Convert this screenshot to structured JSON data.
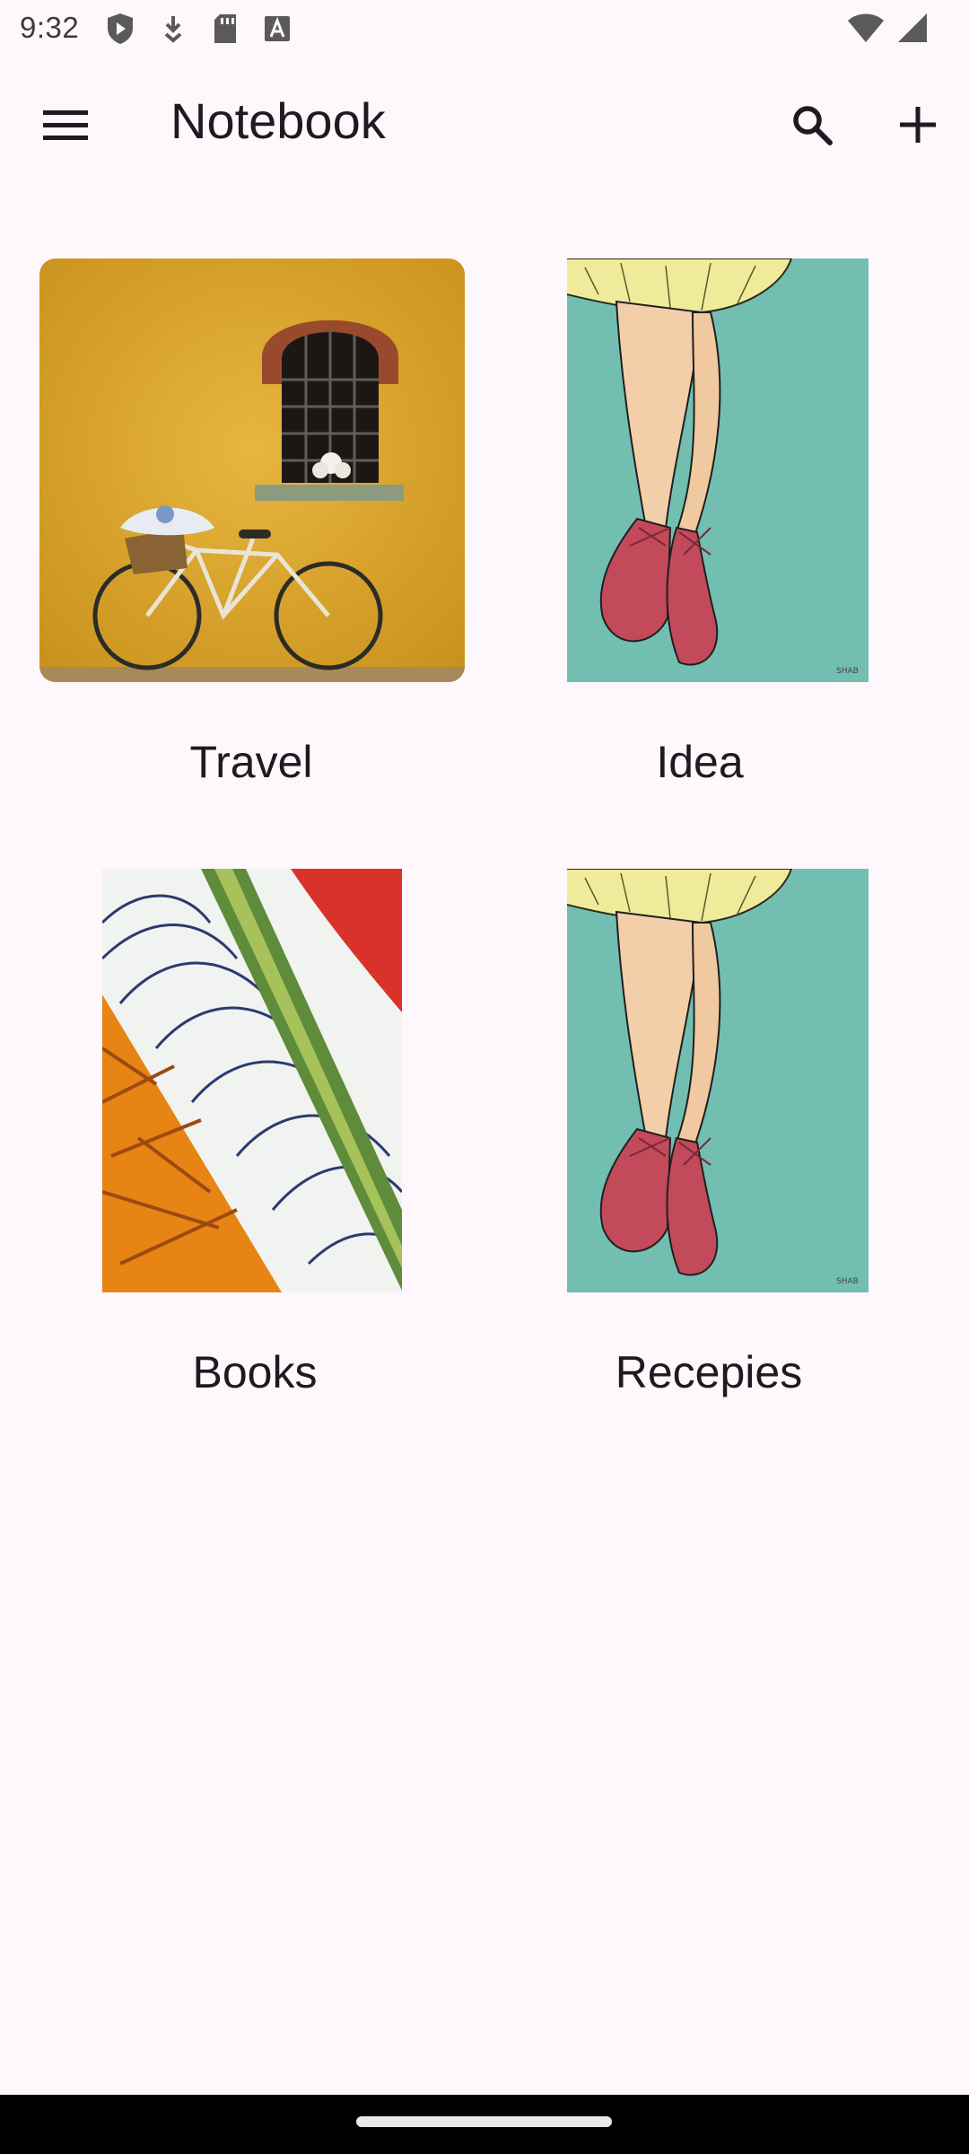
{
  "status_bar": {
    "time": "9:32",
    "left_icons": [
      "shield-icon",
      "download-icon",
      "sd-card-icon",
      "font-icon"
    ],
    "right_icons": [
      "wifi-icon",
      "signal-icon"
    ]
  },
  "app_bar": {
    "title": "Notebook",
    "menu_icon": "hamburger-menu-icon",
    "search_icon": "search-icon",
    "add_icon": "plus-icon"
  },
  "notebooks": [
    {
      "label": "Travel",
      "cover": "yellow wall with bicycle and window"
    },
    {
      "label": "Idea",
      "cover": "ballet dancer legs on teal"
    },
    {
      "label": "Books",
      "cover": "orange, white and red abstract stripes"
    },
    {
      "label": "Recepies",
      "cover": "ballet dancer legs on teal"
    }
  ],
  "colors": {
    "background": "#fef7fb",
    "text": "#1d1b20",
    "nav_bar": "#000000"
  }
}
